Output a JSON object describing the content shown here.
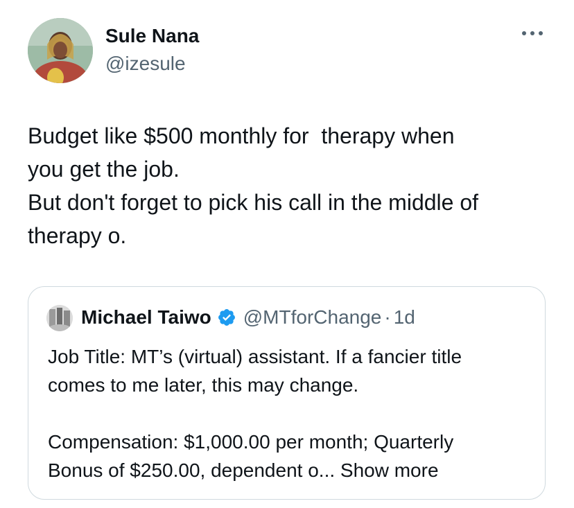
{
  "tweet": {
    "author": {
      "name": "Sule Nana",
      "handle": "@izesule",
      "avatar_icon": "user-avatar-photo"
    },
    "more_icon": "more-dots-icon",
    "text_lines": [
      "Budget like $500 monthly for  therapy when",
      "you get the job.",
      "But don't forget to pick his call in the middle of",
      "therapy o."
    ]
  },
  "quote": {
    "author": {
      "name": "Michael Taiwo",
      "handle": "@MTforChange",
      "separator": "·",
      "time": "1d",
      "verified_icon": "verified-badge-icon",
      "verified_color": "#1d9bf0",
      "avatar_icon": "user-avatar-photo"
    },
    "paragraph1_lines": [
      "Job Title: MT’s (virtual) assistant. If a fancier title",
      "comes to me later, this may change."
    ],
    "paragraph2_lines": [
      "Compensation: $1,000.00 per month; Quarterly",
      "Bonus of $250.00, dependent o..."
    ],
    "show_more": "Show more"
  },
  "colors": {
    "text_primary": "#0f1419",
    "text_secondary": "#536471",
    "border": "#cfd9de"
  }
}
